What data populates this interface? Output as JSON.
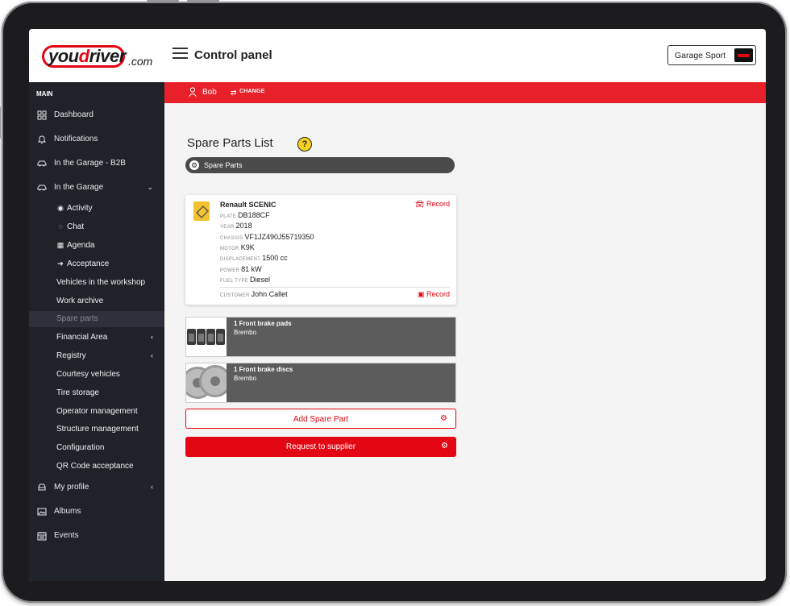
{
  "brand": {
    "logo_you": "you",
    "logo_d": "d",
    "logo_river": "river",
    "logo_com": ".com"
  },
  "header": {
    "title": "Control panel",
    "garage_button": "Garage Sport"
  },
  "userbar": {
    "user": "Bob",
    "change": "CHANGE"
  },
  "sidebar": {
    "section": "MAIN",
    "items": [
      {
        "label": "Dashboard",
        "icon": "dashboard-grid-icon"
      },
      {
        "label": "Notifications",
        "icon": "bell-icon"
      },
      {
        "label": "In the Garage - B2B",
        "icon": "car-icon"
      },
      {
        "label": "In the Garage",
        "icon": "car-icon"
      }
    ],
    "garage_sub": [
      {
        "label": "Activity",
        "icon": "car-front-icon"
      },
      {
        "label": "Chat",
        "icon": "chat-icon"
      },
      {
        "label": "Agenda",
        "icon": "calendar-icon"
      },
      {
        "label": "Acceptance",
        "icon": "arrow-circle-icon"
      }
    ],
    "garage_sub_plain": [
      {
        "label": "Vehicles in the workshop"
      },
      {
        "label": "Work archive"
      },
      {
        "label": "Spare parts"
      },
      {
        "label": "Financial Area"
      },
      {
        "label": "Registry"
      },
      {
        "label": "Courtesy vehicles"
      },
      {
        "label": "Tire storage"
      },
      {
        "label": "Operator management"
      },
      {
        "label": "Structure management"
      },
      {
        "label": "Configuration"
      },
      {
        "label": "QR Code acceptance"
      }
    ],
    "bottom_items": [
      {
        "label": "My profile",
        "icon": "car-profile-icon"
      },
      {
        "label": "Albums",
        "icon": "image-icon"
      },
      {
        "label": "Events",
        "icon": "calendar-events-icon"
      }
    ]
  },
  "main": {
    "title": "Spare Parts List",
    "help": "?",
    "tab": "Spare Parts",
    "vehicle": {
      "title": "Renault SCENIC",
      "record_top": "Record",
      "plate_k": "PLATE",
      "plate": "DB188CF",
      "year_k": "YEAR",
      "year": "2018",
      "chassis_k": "CHASSIS",
      "chassis": "VF1JZ490J55719350",
      "motor_k": "MOTOR",
      "motor": "K9K",
      "displacement_k": "DISPLACEMENT",
      "displacement": "1500 cc",
      "power_k": "POWER",
      "power": "81 kW",
      "fuel_k": "FUEL TYPE",
      "fuel": "Diesel",
      "customer_k": "CUSTOMER",
      "customer": "John Callet",
      "record_bottom": "Record"
    },
    "parts": [
      {
        "name": "1 Front brake pads",
        "brand": "Brembo"
      },
      {
        "name": "1 Front brake discs",
        "brand": "Brembo"
      }
    ],
    "add_button": "Add Spare Part",
    "request_button": "Request to supplier"
  },
  "colors": {
    "accent": "#e30613",
    "sidebar_bg": "#20222a",
    "help_badge": "#f7d21d"
  }
}
